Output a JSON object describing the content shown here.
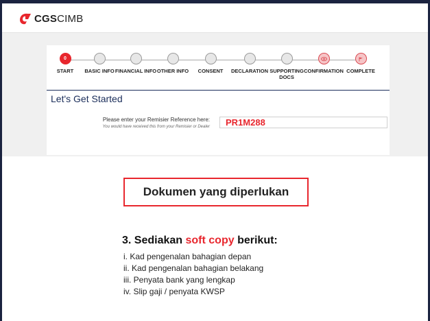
{
  "brand": {
    "name_bold": "CGS",
    "name_light": "CIMB",
    "accent": "#e8262d",
    "navy": "#1a2d5a"
  },
  "stepper": {
    "steps": [
      {
        "label": "START",
        "state": "active",
        "glyph": "0"
      },
      {
        "label": "BASIC INFO",
        "state": "pending"
      },
      {
        "label": "FINANCIAL INFO",
        "state": "pending"
      },
      {
        "label": "OTHER INFO",
        "state": "pending"
      },
      {
        "label": "CONSENT",
        "state": "pending"
      },
      {
        "label": "DECLARATION",
        "state": "pending"
      },
      {
        "label": "SUPPORTING DOCS",
        "state": "pending"
      },
      {
        "label": "CONFIRMATION",
        "state": "pink",
        "icon": "eye-icon"
      },
      {
        "label": "COMPLETE",
        "state": "pink",
        "icon": "flag-icon"
      }
    ]
  },
  "form": {
    "title": "Let's Get Started",
    "remisier_label": "Please enter your Remisier Reference here:",
    "remisier_hint": "You would have received this from your Remisier or Dealer",
    "remisier_value": "PR1M288"
  },
  "overlay": {
    "box_title": "Dokumen yang diperlukan",
    "list_title_pre": "3. Sediakan ",
    "list_title_highlight": "soft copy",
    "list_title_post": " berikut:",
    "items": [
      "i.  Kad pengenalan bahagian depan",
      "ii.  Kad pengenalan bahagian belakang",
      "iii. Penyata bank yang lengkap",
      "iv. Slip gaji / penyata KWSP"
    ]
  }
}
